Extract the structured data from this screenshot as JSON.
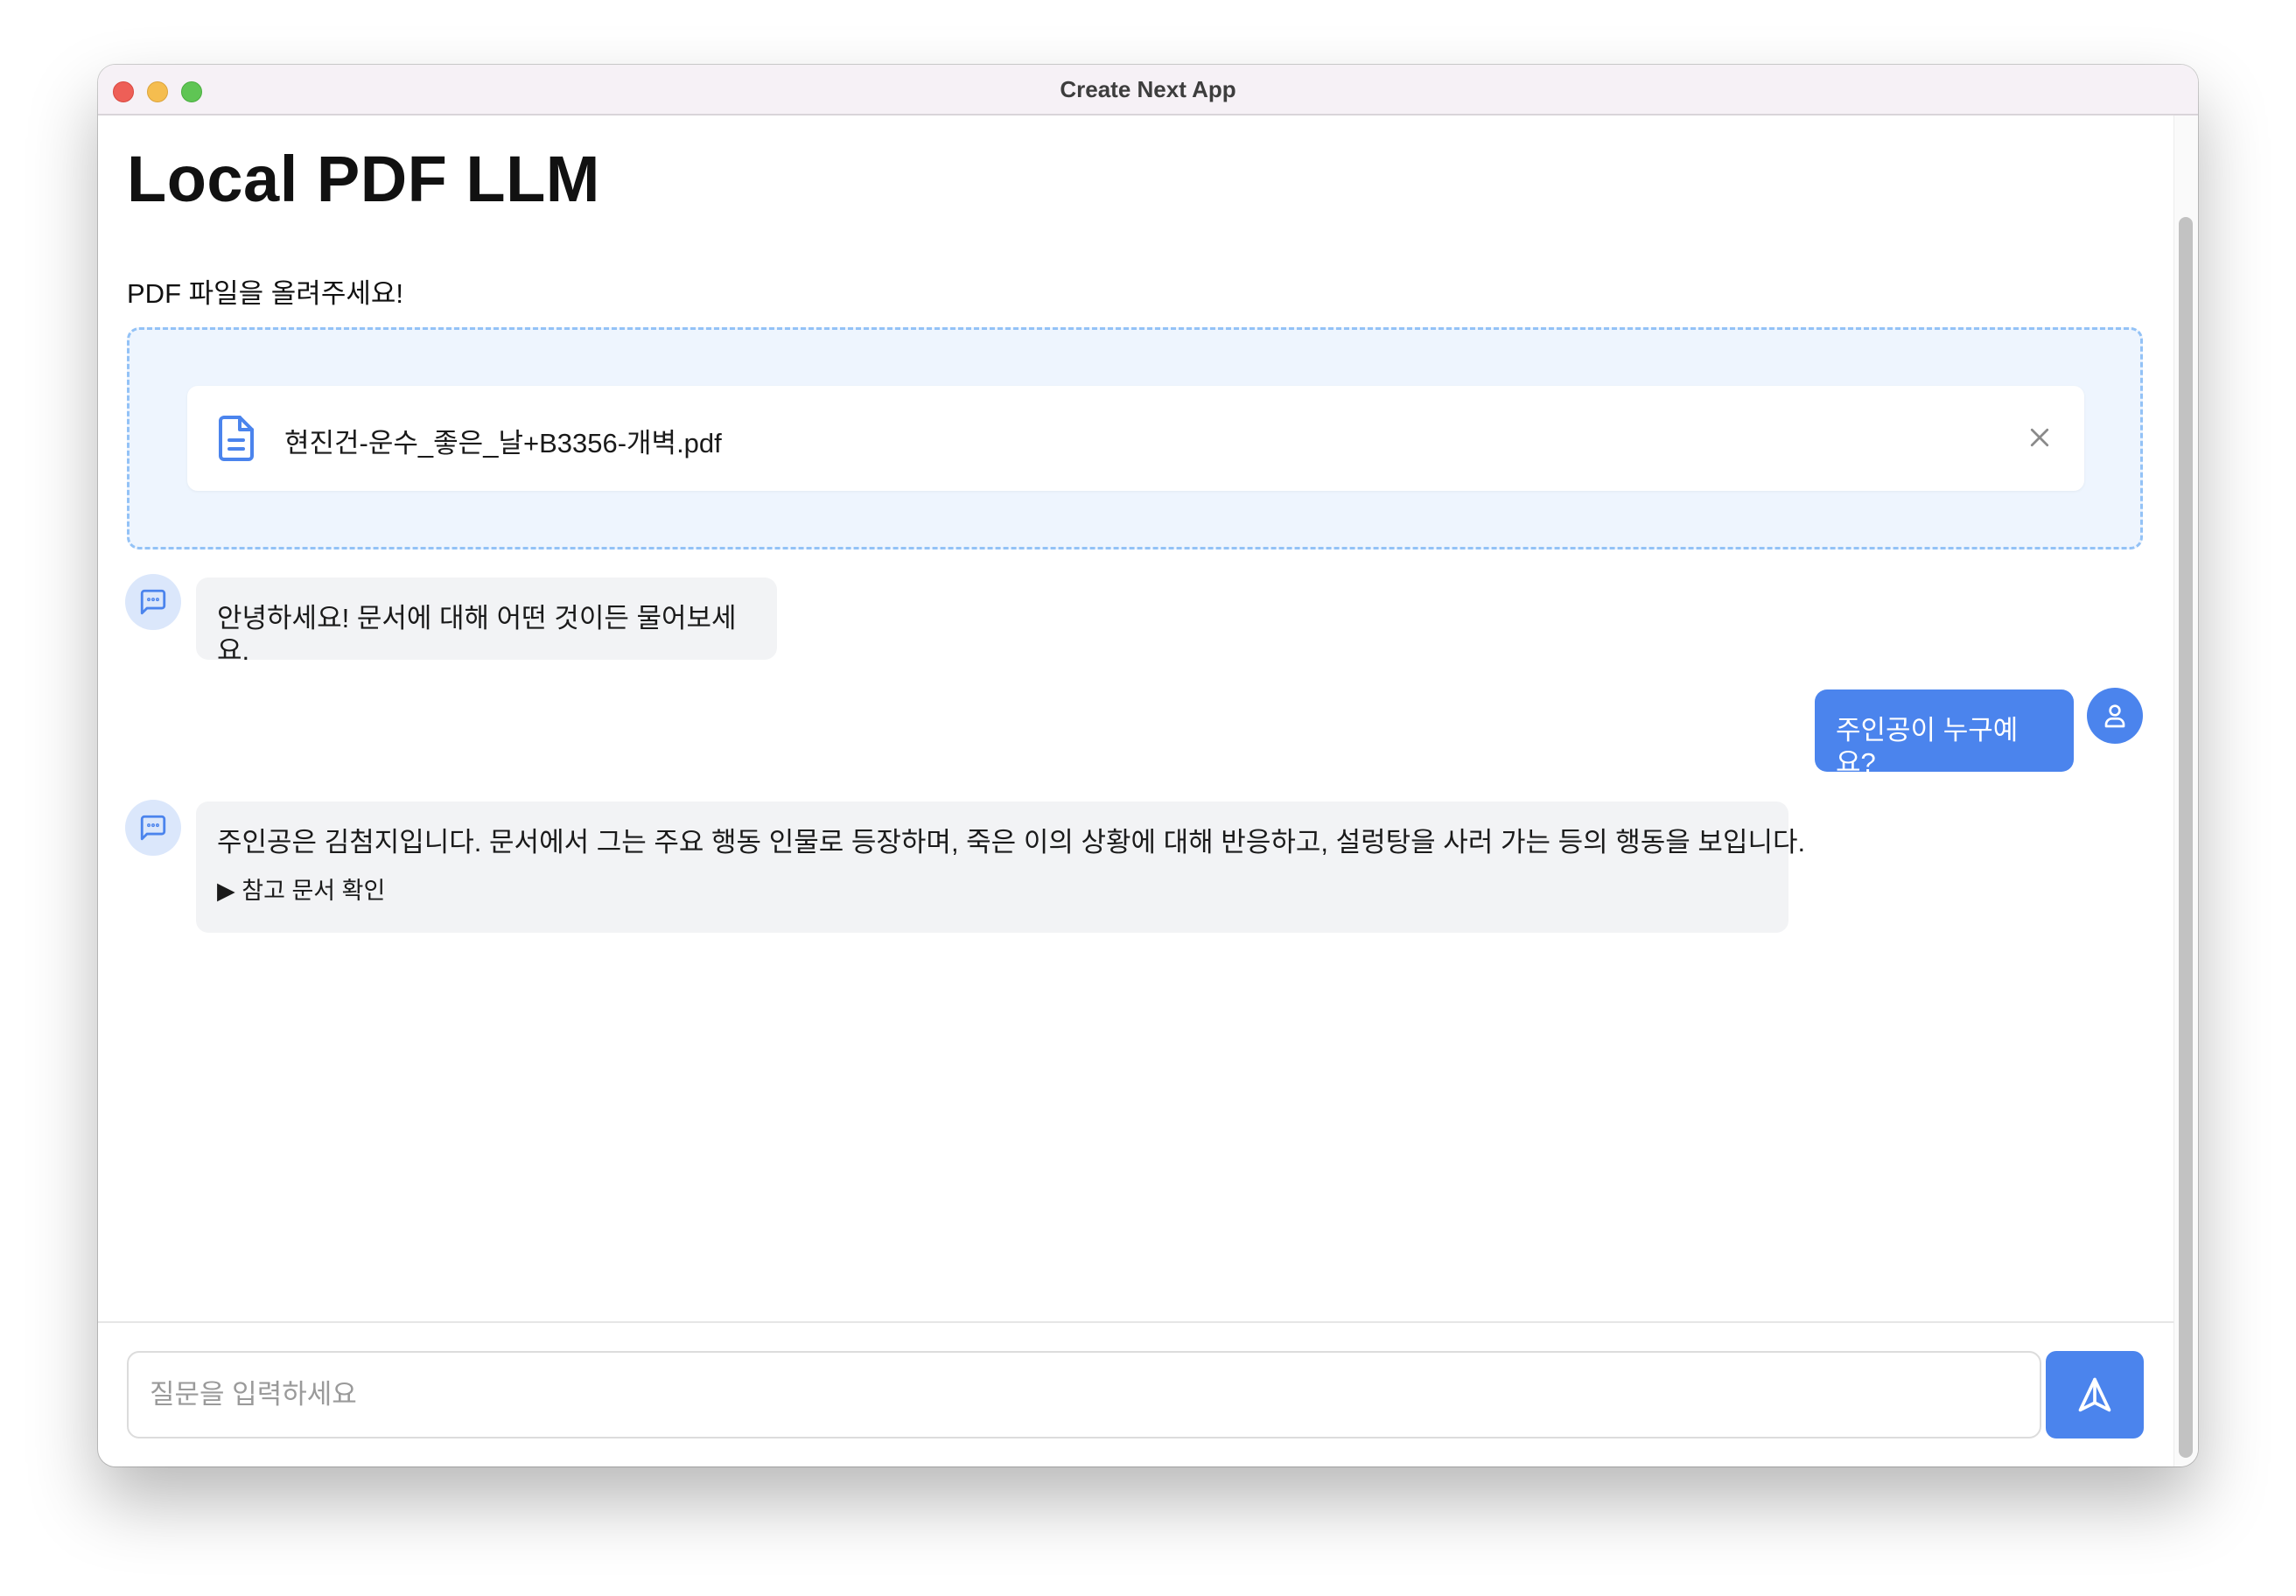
{
  "window": {
    "title": "Create Next App"
  },
  "page": {
    "title": "Local PDF LLM"
  },
  "upload": {
    "label": "PDF 파일을 올려주세요!",
    "file_name": "현진건-운수_좋은_날+B3356-개벽.pdf"
  },
  "messages": [
    {
      "role": "assistant",
      "text": "안녕하세요! 문서에 대해 어떤 것이든 물어보세요."
    },
    {
      "role": "user",
      "text": "주인공이 누구예요?"
    },
    {
      "role": "assistant",
      "text": "주인공은 김첨지입니다. 문서에서 그는 주요 행동 인물로 등장하며, 죽은 이의 상황에 대해 반응하고, 설렁탕을 사러 가는 등의 행동을 보입니다.",
      "reference_toggle": "▶ 참고 문서 확인"
    }
  ],
  "input": {
    "placeholder": "질문을 입력하세요",
    "value": ""
  },
  "colors": {
    "accent": "#4b84ed",
    "bot_bubble": "#f2f3f5",
    "dropzone_bg": "#eef5fe",
    "dropzone_border": "#93c2f6"
  },
  "icons": {
    "file": "file-text-icon",
    "remove": "close-icon",
    "bot": "message-square-dots-icon",
    "user": "user-icon",
    "send": "send-icon"
  }
}
